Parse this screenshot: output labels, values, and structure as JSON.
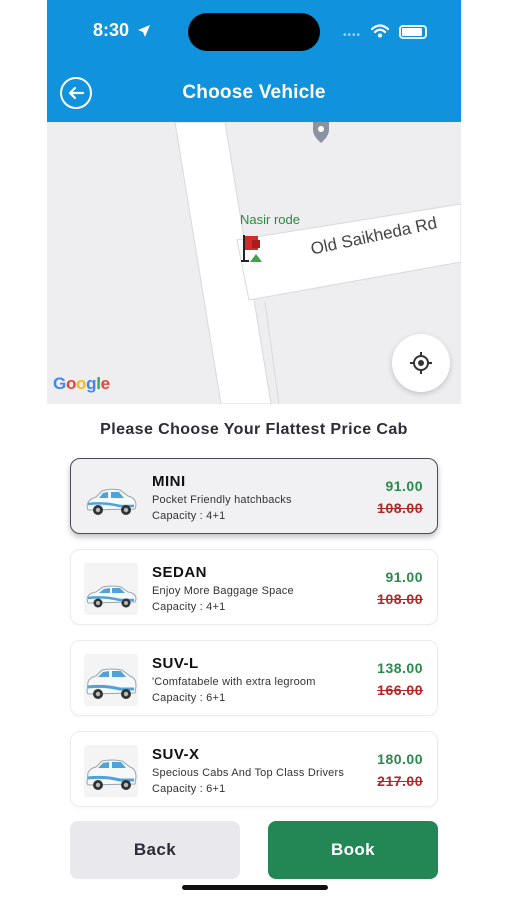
{
  "status_bar": {
    "time": "8:30"
  },
  "header": {
    "title": "Choose Vehicle"
  },
  "map": {
    "road_label": "Old Saikheda Rd",
    "marker_label": "Nasir rode",
    "logo_letters": [
      "G",
      "o",
      "o",
      "g",
      "l",
      "e"
    ]
  },
  "section_title": "Please Choose Your Flattest Price Cab",
  "cabs": [
    {
      "name": "MINI",
      "description": "Pocket Friendly hatchbacks",
      "capacity": "Capacity : 4+1",
      "price": "91.00",
      "old_price": "108.00",
      "selected": true
    },
    {
      "name": "SEDAN",
      "description": "Enjoy More Baggage Space",
      "capacity": "Capacity : 4+1",
      "price": "91.00",
      "old_price": "108.00",
      "selected": false
    },
    {
      "name": "SUV-L",
      "description": "'Comfatabele with extra legroom",
      "capacity": "Capacity : 6+1",
      "price": "138.00",
      "old_price": "166.00",
      "selected": false
    },
    {
      "name": "SUV-X",
      "description": "Specious Cabs And Top Class Drivers",
      "capacity": "Capacity : 6+1",
      "price": "180.00",
      "old_price": "217.00",
      "selected": false
    }
  ],
  "buttons": {
    "back": "Back",
    "book": "Book"
  },
  "colors": {
    "header": "#1192dc",
    "price": "#2a8a4a",
    "old_price": "#b32626",
    "book_button": "#238755"
  }
}
